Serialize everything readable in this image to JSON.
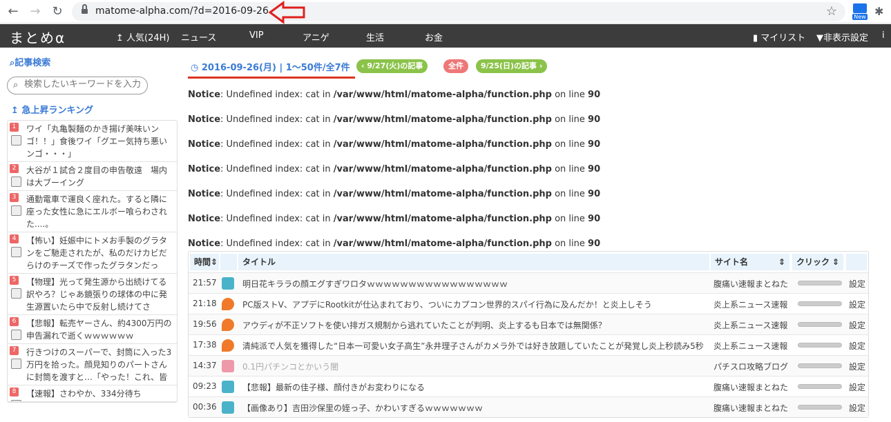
{
  "browser": {
    "url": "matome-alpha.com/?d=2016-09-26",
    "ext_new_label": "New"
  },
  "header": {
    "logo": "まとめα",
    "nav": [
      "人気(24H)",
      "ニュース",
      "VIP",
      "アニゲ",
      "生活",
      "お金"
    ],
    "mylist": "マイリスト",
    "hide_settings": "非表示設定"
  },
  "sidebar": {
    "search_heading": "記事検索",
    "search_placeholder": "検索したいキーワードを入力",
    "ranking_heading": "急上昇ランキング",
    "ranking": [
      {
        "no": "1",
        "text": "ワイ「丸亀製麺のかき揚げ美味いンゴ！！」食後ワイ「グエー気持ち悪いンゴ・・・」"
      },
      {
        "no": "2",
        "text": "大谷が１試合２度目の申告敬遠　場内は大ブーイング"
      },
      {
        "no": "3",
        "text": "通勤電車で運良く座れた。すると隣に座った女性に急にエルボー喰らわされた....。"
      },
      {
        "no": "4",
        "text": "【怖い】妊娠中にトメお手製のグラタンをご馳走されたが、私のだけカビだらけのチーズで作ったグラタンだった。ト..."
      },
      {
        "no": "5",
        "text": "【物理】光って発生源から出続けてる訳やろ？じゃあ鏡張りの球体の中に発生源置いたら中で反射し続けてさ"
      },
      {
        "no": "6",
        "text": "【悲報】転売ヤーさん、約4300万円の申告漏れで逝くｗｗｗｗｗｗ"
      },
      {
        "no": "7",
        "text": "行きつけのスーパーで、封筒に入った3万円を拾った。顔見知りのパートさんに封筒を渡すと…「やった！これ、皆で..."
      },
      {
        "no": "8",
        "text": "【速報】さわやか、334分待ち"
      }
    ]
  },
  "main": {
    "date_heading": "2016-09-26(月) | 1〜50件/全7件",
    "prev_label": "9/27(火)の記事",
    "all_label": "全件",
    "next_label": "9/25(日)の記事",
    "notice_prefix": "Notice",
    "notice_msg": ": Undefined index: cat in ",
    "notice_path": "/var/www/html/matome-alpha/function.php",
    "notice_on": " on line ",
    "notice_line": "90",
    "notice_count": 7,
    "table": {
      "headers": {
        "time": "時間",
        "title": "タイトル",
        "site": "サイト名",
        "click": "クリック"
      },
      "rows": [
        {
          "time": "21:57",
          "title": "明日花キララの顔エグすぎワロタｗｗｗｗｗｗｗｗｗｗｗｗｗｗｗｗｗ",
          "site": "腹痛い速報まとねた",
          "set": "設定"
        },
        {
          "time": "21:18",
          "title": "PC版ストV、アプデにRootkitが仕込まれており、ついにカプコン世界的スパイ行為に及んだか！と炎上しそう",
          "site": "炎上系ニュース速報",
          "set": "設定"
        },
        {
          "time": "19:56",
          "title": "アウディが不正ソフトを使い排ガス規制から逃れていたことが判明、炎上するも日本では無関係？",
          "site": "炎上系ニュース速報",
          "set": "設定"
        },
        {
          "time": "17:38",
          "title": "清純派で人気を獲得した“日本一可愛い女子高生”永井理子さんがカメラ外では好き放題していたことが発覚し炎上秒読み5秒",
          "site": "炎上系ニュース速報",
          "set": "設定"
        },
        {
          "time": "14:37",
          "title": "0.1円パチンコとかいう闇",
          "site": "パチスロ攻略ブログ",
          "set": "設定"
        },
        {
          "time": "09:23",
          "title": "【悲報】最新の佳子様、顔付きがお変わりになる",
          "site": "腹痛い速報まとねた",
          "set": "設定"
        },
        {
          "time": "00:36",
          "title": "【画像あり】吉田沙保里の姪っ子、かわいすぎるｗｗｗｗｗｗｗ",
          "site": "腹痛い速報まとねた",
          "set": "設定"
        }
      ]
    }
  }
}
